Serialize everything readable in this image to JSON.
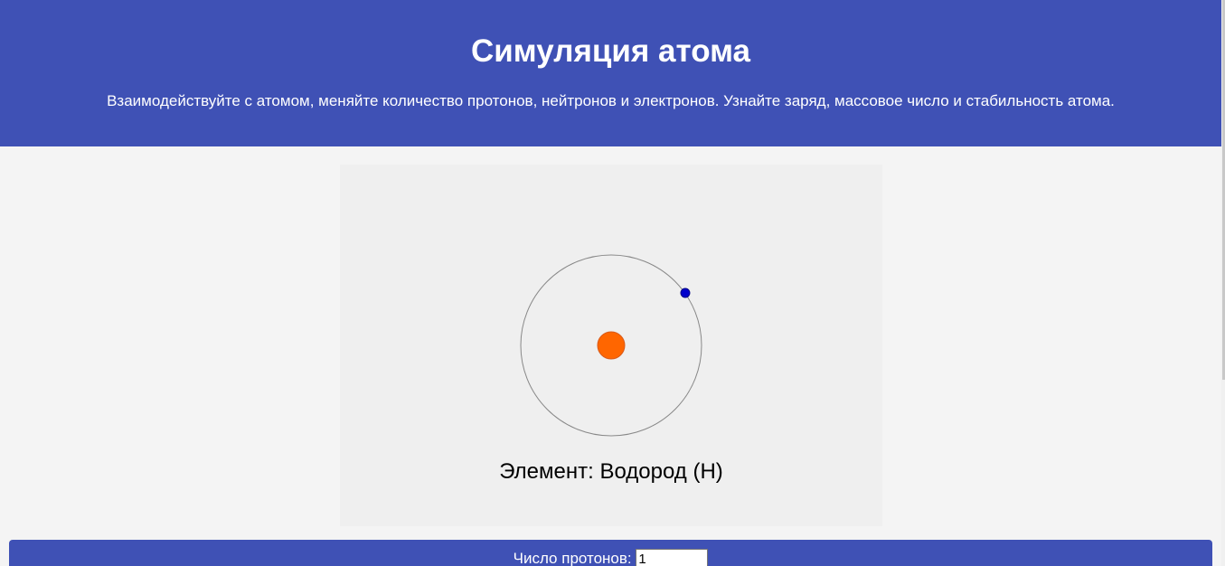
{
  "header": {
    "title": "Симуляция атома",
    "description": "Взаимодействуйте с атомом, меняйте количество протонов, нейтронов и электронов. Узнайте заряд, массовое число и стабильность атома."
  },
  "simulation": {
    "element_label": "Элемент: Водород (H)"
  },
  "controls": {
    "protons_label": "Число протонов:",
    "protons_value": "1"
  },
  "colors": {
    "header_bg": "#3f51b5",
    "nucleus": "#ff6600",
    "electron": "#0000cc",
    "orbit": "#888888"
  }
}
